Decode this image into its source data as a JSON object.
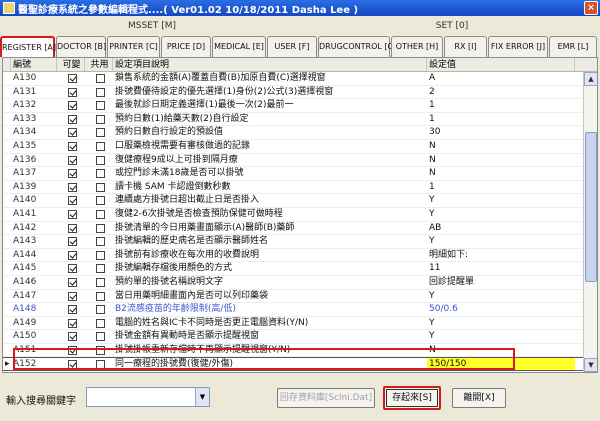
{
  "window": {
    "title": "醫聖診療系統之參數編輯程式....( Ver01.02 10/18/2011 Dasha Lee )",
    "close": "×"
  },
  "groups": [
    "MSSET [M]",
    "SET [0]"
  ],
  "tabs": [
    "REGISTER [A]",
    "DOCTOR [B]",
    "PRINTER [C]",
    "PRICE [D]",
    "MEDICAL [E]",
    "USER [F]",
    "DRUGCONTROL [G]",
    "OTHER [H]",
    "RX [I]",
    "FIX ERROR [J]",
    "EMR [L]"
  ],
  "columns": [
    "編號",
    "可變",
    "共用",
    "設定項目說明",
    "設定值"
  ],
  "rows": [
    {
      "code": "A130",
      "var": true,
      "shr": false,
      "desc": "鎖售系統的金額(A)覆蓋自費(B)加原自費(C)選擇視窗",
      "val": "A"
    },
    {
      "code": "A131",
      "var": true,
      "shr": false,
      "desc": "掛號費優待設定的優先選擇(1)身份(2)公式(3)選擇視窗",
      "val": "2"
    },
    {
      "code": "A132",
      "var": true,
      "shr": false,
      "desc": "最後就診日期定義選擇(1)最後一次(2)最前一",
      "val": "1"
    },
    {
      "code": "A133",
      "var": true,
      "shr": false,
      "desc": "預約日數(1)給藥天數(2)自行設定",
      "val": "1"
    },
    {
      "code": "A134",
      "var": true,
      "shr": false,
      "desc": "預約日數自行設定的預設值",
      "val": "30"
    },
    {
      "code": "A135",
      "var": true,
      "shr": false,
      "desc": "口服藥檢視需要有審核做過的記錄",
      "val": "N"
    },
    {
      "code": "A136",
      "var": true,
      "shr": false,
      "desc": "復健療程9成以上可掛到隔月療",
      "val": "N"
    },
    {
      "code": "A137",
      "var": true,
      "shr": false,
      "desc": "或控門診未滿18歲是否可以掛號",
      "val": "N"
    },
    {
      "code": "A139",
      "var": true,
      "shr": false,
      "desc": "讀卡機 SAM 卡認證倒數秒數",
      "val": "1"
    },
    {
      "code": "A140",
      "var": true,
      "shr": false,
      "desc": "連續處方掛號日超出截止日是否掛入",
      "val": "Y"
    },
    {
      "code": "A141",
      "var": true,
      "shr": false,
      "desc": "復健2-6次掛號是否檢查預防保健可做時程",
      "val": "Y"
    },
    {
      "code": "A142",
      "var": true,
      "shr": false,
      "desc": "掛號清單的今日用藥畫面顯示(A)醫師(B)藥師",
      "val": "AB"
    },
    {
      "code": "A143",
      "var": true,
      "shr": false,
      "desc": "掛號編輯的歷史病名是否顯示醫師姓名",
      "val": "Y"
    },
    {
      "code": "A144",
      "var": true,
      "shr": false,
      "desc": "掛號前有診療收在每次用的收費說明",
      "val": "明細如下:"
    },
    {
      "code": "A145",
      "var": true,
      "shr": false,
      "desc": "掛號編輯存檔後用顏色的方式",
      "val": "11"
    },
    {
      "code": "A146",
      "var": true,
      "shr": false,
      "desc": "預約單的掛號名稱說明文字",
      "val": "回診提醒單"
    },
    {
      "code": "A147",
      "var": true,
      "shr": false,
      "desc": "當日用藥明細畫面內是否可以列印藥袋",
      "val": "Y"
    },
    {
      "code": "A148",
      "var": true,
      "shr": false,
      "desc": "B2流感疫苗的年齡限制(高/低)",
      "val": "50/0.6",
      "blue": true
    },
    {
      "code": "A149",
      "var": true,
      "shr": false,
      "desc": "電腦的姓名與IC卡不同時是否更正電腦資料(Y/N)",
      "val": "Y"
    },
    {
      "code": "A150",
      "var": true,
      "shr": false,
      "desc": "掛號金額有異動時是否顯示提醒視窗",
      "val": "Y"
    },
    {
      "code": "A151",
      "var": true,
      "shr": false,
      "desc": "掛號掛帳重新存檔時不再顯示提醒視窗(Y/N)",
      "val": "N"
    },
    {
      "code": "A152",
      "var": true,
      "shr": false,
      "desc": "同一療程的掛號費(復健/外傷)",
      "val": "150/150",
      "selected": true
    }
  ],
  "bottom": {
    "search_label": "輸入搜尋關鍵字",
    "search_value": "",
    "restore_button": "回存資料庫[Sclni.Dat]",
    "save_button": "存起來[S]",
    "exit_button": "離開[X]"
  }
}
